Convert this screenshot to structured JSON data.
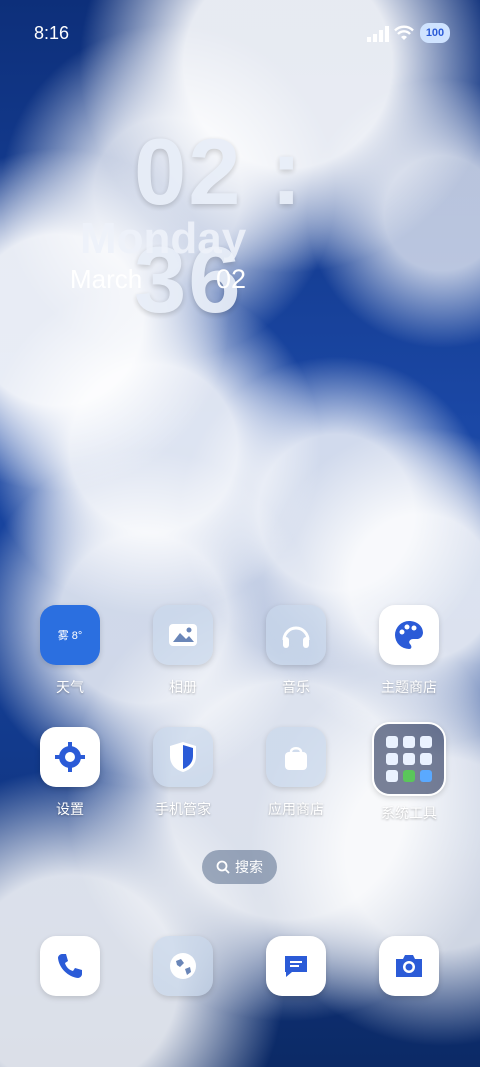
{
  "status_bar": {
    "time": "8:16",
    "battery": "100"
  },
  "clock": {
    "time": "02 : 36",
    "weekday": "Monday",
    "month": "March",
    "day": "02"
  },
  "apps_row1": [
    {
      "name": "weather",
      "label": "天气",
      "icon_text": "雾 8°"
    },
    {
      "name": "gallery",
      "label": "相册"
    },
    {
      "name": "music",
      "label": "音乐"
    },
    {
      "name": "theme-store",
      "label": "主题商店"
    }
  ],
  "apps_row2": [
    {
      "name": "settings",
      "label": "设置"
    },
    {
      "name": "phone-manager",
      "label": "手机管家"
    },
    {
      "name": "app-store",
      "label": "应用商店"
    },
    {
      "name": "system-tools",
      "label": "系统工具"
    }
  ],
  "search": {
    "label": "搜索"
  },
  "dock": [
    {
      "name": "phone",
      "icon": "phone-icon"
    },
    {
      "name": "browser",
      "icon": "globe-icon"
    },
    {
      "name": "messages",
      "icon": "message-icon"
    },
    {
      "name": "camera",
      "icon": "camera-icon"
    }
  ],
  "colors": {
    "accent": "#2b5bd7",
    "icon_bg": "#ffffff"
  }
}
